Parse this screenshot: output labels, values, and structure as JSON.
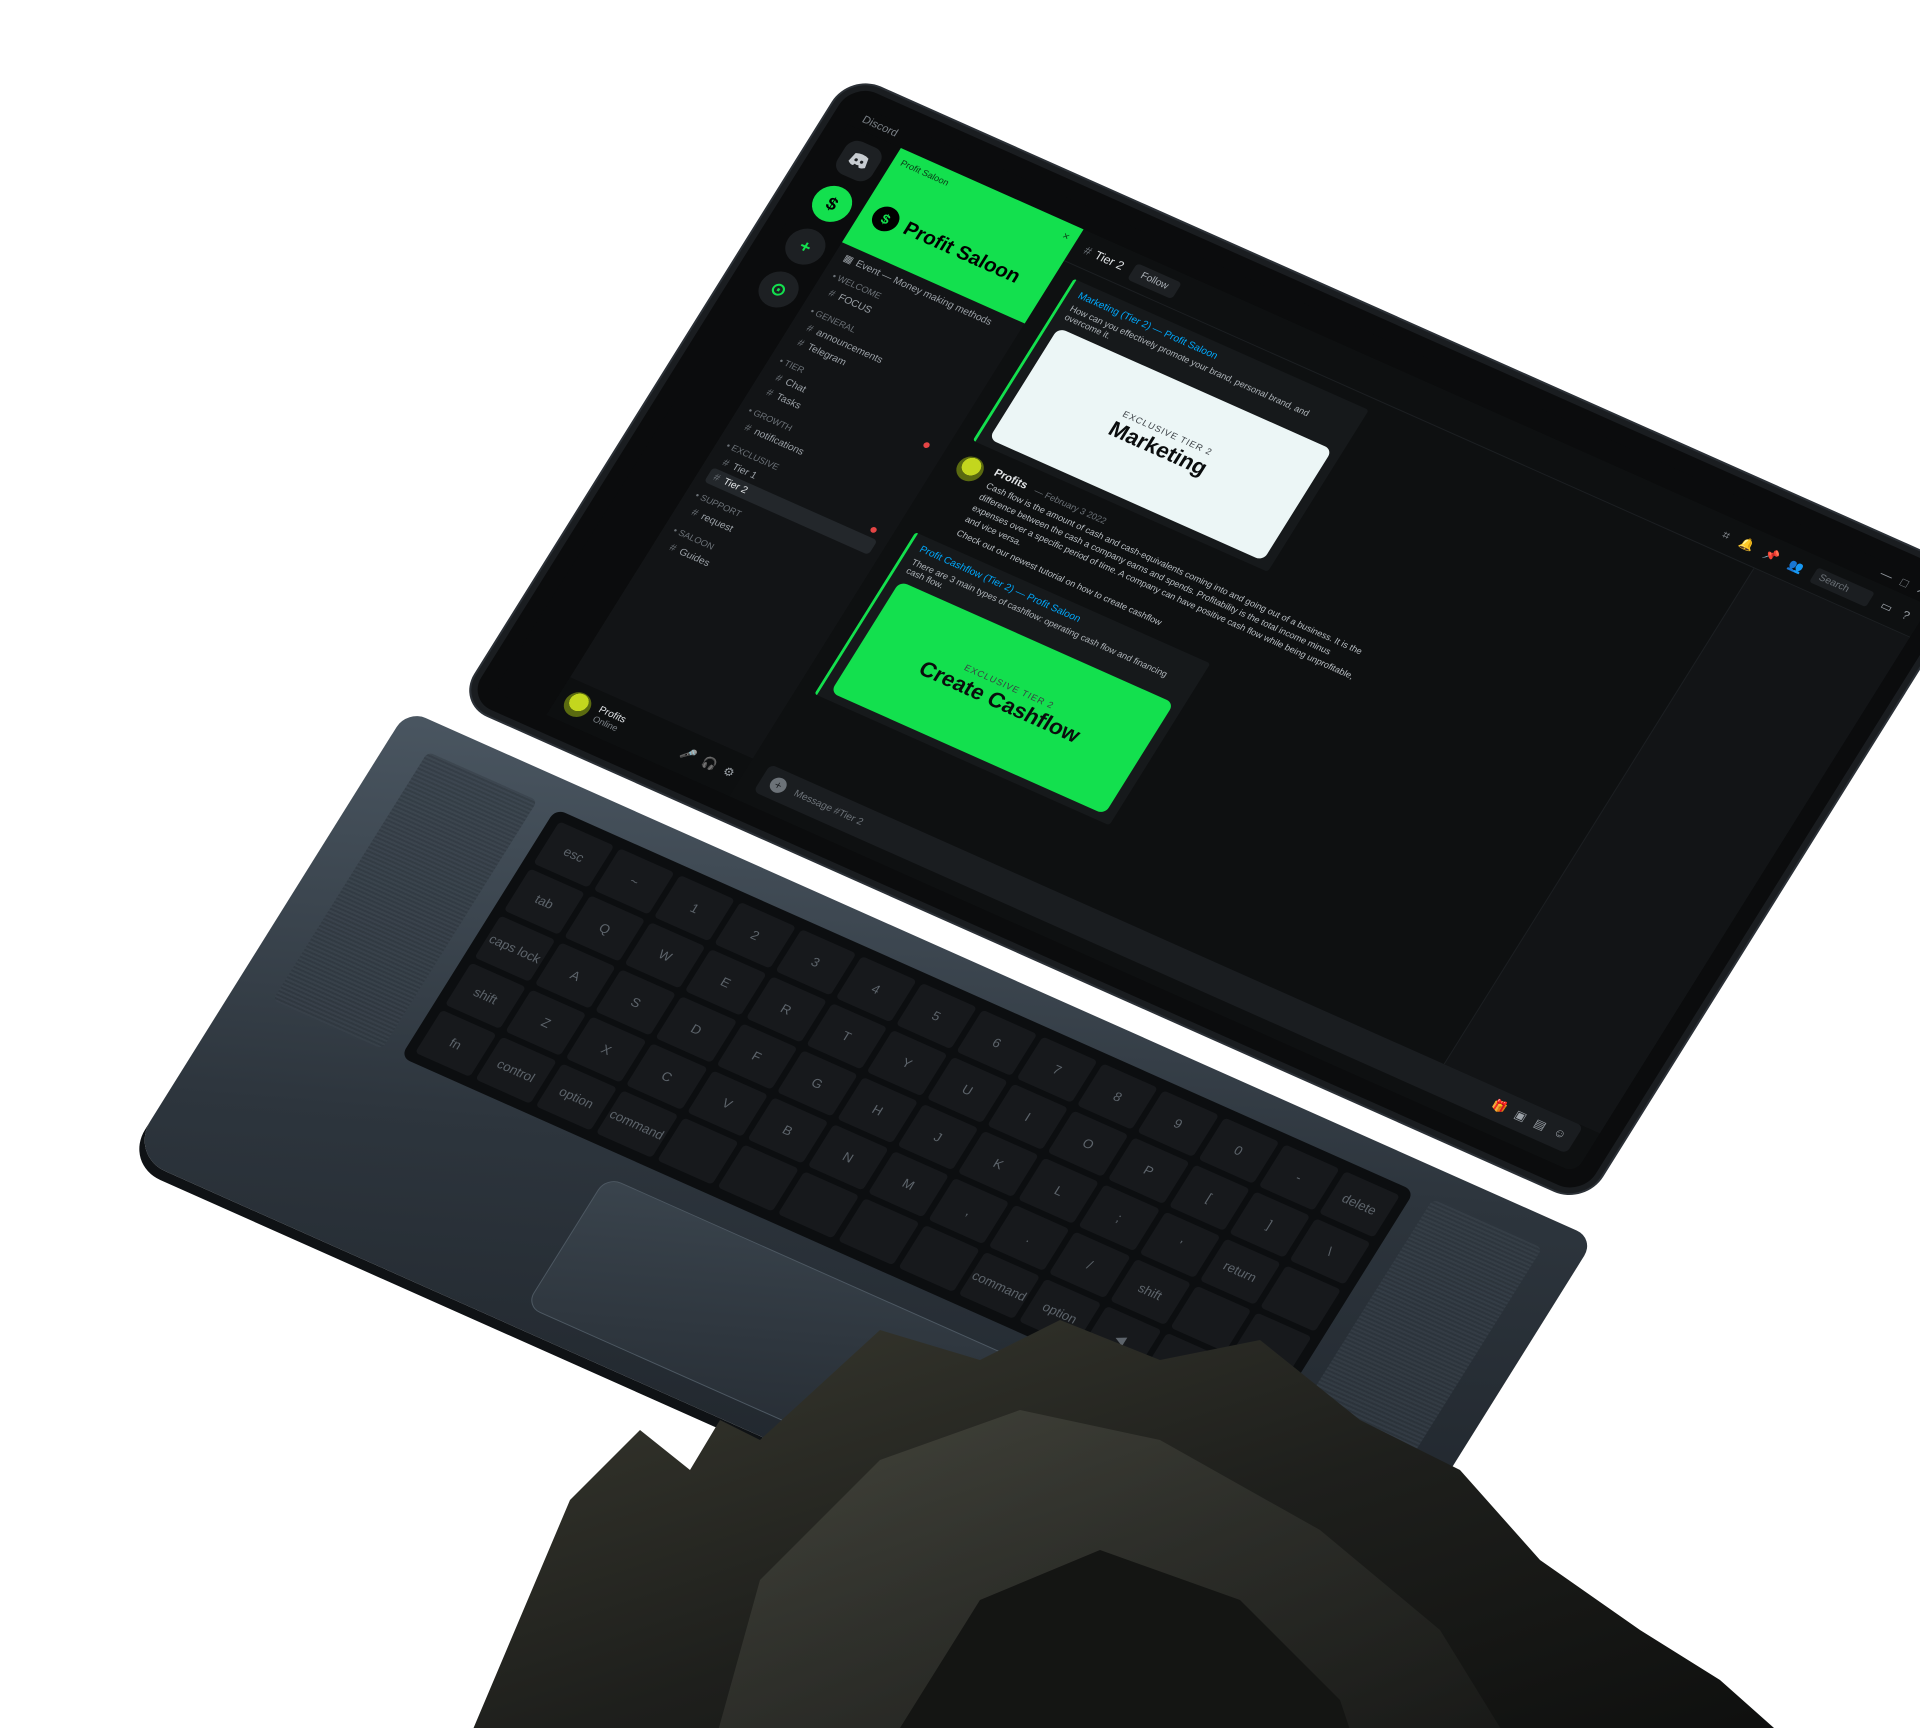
{
  "window": {
    "app_title": "Discord",
    "controls": [
      "—",
      "□",
      "✕"
    ]
  },
  "rail": {
    "home_icon": "discord-icon",
    "server_initial": "$",
    "add_icon": "+",
    "explore_icon": "⊙"
  },
  "server": {
    "banner_label": "Profit Saloon",
    "name": "Profit Saloon",
    "logo": "$",
    "close": "×"
  },
  "sidebar": {
    "event_link": "Event — Money making methods",
    "categories": [
      {
        "label": "• Welcome",
        "channels": [
          {
            "name": "FOCUS"
          }
        ]
      },
      {
        "label": "• General",
        "channels": [
          {
            "name": "announcements"
          },
          {
            "name": "Telegram"
          }
        ]
      },
      {
        "label": "• Tier",
        "channels": [
          {
            "name": "Chat"
          },
          {
            "name": "Tasks"
          }
        ]
      },
      {
        "label": "• Growth",
        "channels": [
          {
            "name": "notifications"
          }
        ]
      },
      {
        "label": "• Exclusive",
        "channels": [
          {
            "name": "Tier 1"
          },
          {
            "name": "Tier 2"
          }
        ]
      },
      {
        "label": "• Support",
        "channels": [
          {
            "name": "request"
          }
        ]
      },
      {
        "label": "• Saloon",
        "channels": [
          {
            "name": "Guides"
          }
        ]
      }
    ]
  },
  "user": {
    "name": "Profits",
    "status": "Online",
    "controls": [
      "🎤",
      "🎧",
      "⚙"
    ]
  },
  "topbar": {
    "channel": "Tier 2",
    "tab": "Follow",
    "search_placeholder": "Search"
  },
  "messages": {
    "embed1": {
      "link": "Marketing (Tier 2) — Profit Saloon",
      "desc": "How can you effectively promote your brand, personal brand, and overcome it.",
      "kicker": "EXCLUSIVE TIER 2",
      "title": "Marketing"
    },
    "post": {
      "author": "Profits",
      "time": "— February 3 2022",
      "text": "Cash flow is the amount of cash and cash-equivalents coming into and going out of a business. It is the difference between the cash a company earns and spends. Profitability is the total income minus expenses over a specific period of time. A company can have positive cash flow while being unprofitable, and vice versa.",
      "cta": "Check out our newest tutorial on how to create cashflow"
    },
    "embed2": {
      "link": "Profit Cashflow (Tier 2) — Profit Saloon",
      "desc": "There are 3 main types of cashflow: operating cash flow and financing cash flow.",
      "kicker": "EXCLUSIVE TIER 2",
      "title": "Create Cashflow"
    }
  },
  "composer": {
    "placeholder": "Message #Tier 2",
    "plus": "+"
  },
  "keyboard": {
    "keys": [
      "esc",
      "~",
      "1",
      "2",
      "3",
      "4",
      "5",
      "6",
      "7",
      "8",
      "9",
      "0",
      "-",
      "delete",
      "tab",
      "Q",
      "W",
      "E",
      "R",
      "T",
      "Y",
      "U",
      "I",
      "O",
      "P",
      "[",
      "]",
      "\\",
      "caps lock",
      "A",
      "S",
      "D",
      "F",
      "G",
      "H",
      "J",
      "K",
      "L",
      ";",
      "'",
      "return",
      "",
      "shift",
      "Z",
      "X",
      "C",
      "V",
      "B",
      "N",
      "M",
      ",",
      ".",
      "/",
      "shift",
      "",
      "",
      "fn",
      "control",
      "option",
      "command",
      "",
      "",
      "",
      "",
      "",
      "command",
      "option",
      "◀",
      "▼",
      "▶"
    ]
  }
}
